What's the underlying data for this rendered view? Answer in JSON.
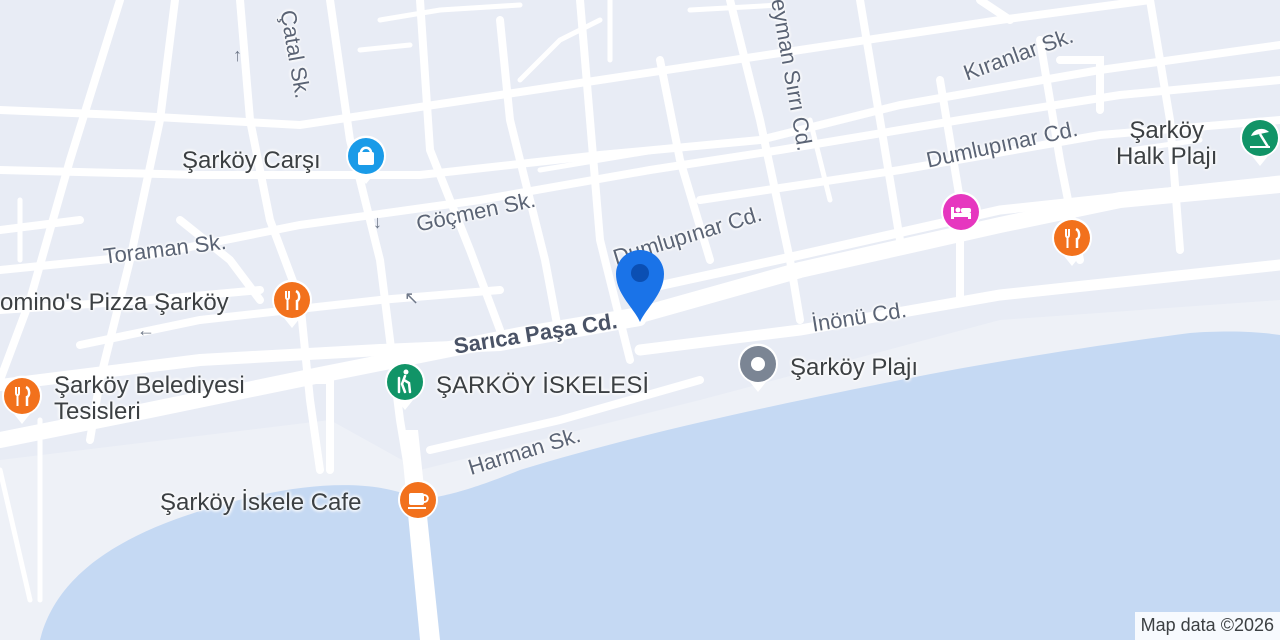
{
  "map": {
    "colors": {
      "land": "#e8ecf5",
      "road": "#ffffff",
      "major_road": "#ffffff",
      "water": "#c5d9f3",
      "beach": "#eef1f7",
      "location_pin": "#1a73e8"
    },
    "streets": {
      "catal": "Çatal Sk.",
      "suleyman_sirri": "leyman Sırrı Cd.",
      "kiranlar": "Kıranlar Sk.",
      "dumlupinar_east": "Dumlupınar Cd.",
      "dumlupinar_west": "Dumlupınar Cd.",
      "gocmen": "Göçmen Sk.",
      "toraman": "Toraman Sk.",
      "sarica_pasa": "Sarıca Paşa Cd.",
      "inonu": "İnönü Cd.",
      "harman": "Harman Sk."
    },
    "pois": {
      "carsi": {
        "name": "Şarköy Carşı",
        "icon": "shopping-bag-icon",
        "color": "#1a9be8"
      },
      "halk_plaji": {
        "name": "Şarköy\nHalk Plajı",
        "icon": "beach-umbrella-icon",
        "color": "#119467"
      },
      "hotel": {
        "name": "",
        "icon": "bed-icon",
        "color": "#e637bf"
      },
      "restaurant_east": {
        "name": "",
        "icon": "fork-knife-icon",
        "color": "#f2711c"
      },
      "dominos": {
        "name": "omino's Pizza Şarköy",
        "icon": "fork-knife-icon",
        "color": "#f2711c"
      },
      "belediye": {
        "name": "Şarköy Belediyesi\nTesisleri",
        "icon": "fork-knife-icon",
        "color": "#f2711c"
      },
      "iskelesi": {
        "name": "ŞARKÖY İSKELESİ",
        "icon": "hiker-icon",
        "color": "#119467"
      },
      "plaji": {
        "name": "Şarköy Plajı",
        "icon": "location-dot-icon",
        "color": "#7b8594"
      },
      "iskele_cafe": {
        "name": "Şarköy İskele Cafe",
        "icon": "coffee-cup-icon",
        "color": "#f2711c"
      }
    },
    "attribution": "Map data ©2026"
  }
}
